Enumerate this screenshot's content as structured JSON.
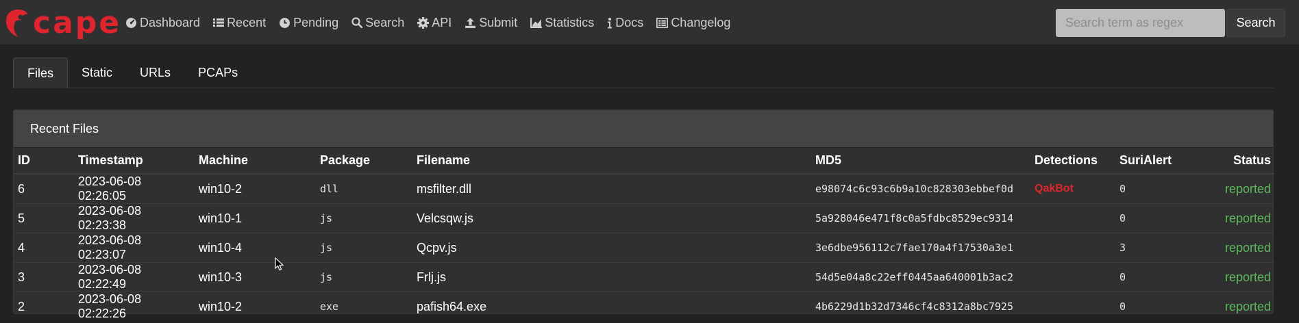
{
  "brand": {
    "name": "cape"
  },
  "nav": {
    "items": [
      {
        "label": "Dashboard",
        "icon": "dashboard-icon"
      },
      {
        "label": "Recent",
        "icon": "list-icon"
      },
      {
        "label": "Pending",
        "icon": "clock-icon"
      },
      {
        "label": "Search",
        "icon": "search-icon"
      },
      {
        "label": "API",
        "icon": "gear-icon"
      },
      {
        "label": "Submit",
        "icon": "upload-icon"
      },
      {
        "label": "Statistics",
        "icon": "chart-icon"
      },
      {
        "label": "Docs",
        "icon": "info-icon"
      },
      {
        "label": "Changelog",
        "icon": "changelog-icon"
      }
    ],
    "search_placeholder": "Search term as regex",
    "search_button": "Search"
  },
  "tabs": [
    "Files",
    "Static",
    "URLs",
    "PCAPs"
  ],
  "panel": {
    "title": "Recent Files",
    "columns": [
      "ID",
      "Timestamp",
      "Machine",
      "Package",
      "Filename",
      "MD5",
      "Detections",
      "SuriAlert",
      "Status"
    ],
    "rows": [
      {
        "id": "6",
        "timestamp": "2023-06-08 02:26:05",
        "machine": "win10-2",
        "package": "dll",
        "filename": "msfilter.dll",
        "md5": "e98074c6c93c6b9a10c828303ebbef0d",
        "detections": "QakBot",
        "surialert": "0",
        "status": "reported"
      },
      {
        "id": "5",
        "timestamp": "2023-06-08 02:23:38",
        "machine": "win10-1",
        "package": "js",
        "filename": "Velcsqw.js",
        "md5": "5a928046e471f8c0a5fdbc8529ec9314",
        "detections": "",
        "surialert": "0",
        "status": "reported"
      },
      {
        "id": "4",
        "timestamp": "2023-06-08 02:23:07",
        "machine": "win10-4",
        "package": "js",
        "filename": "Qcpv.js",
        "md5": "3e6dbe956112c7fae170a4f17530a3e1",
        "detections": "",
        "surialert": "3",
        "status": "reported"
      },
      {
        "id": "3",
        "timestamp": "2023-06-08 02:22:49",
        "machine": "win10-3",
        "package": "js",
        "filename": "Frlj.js",
        "md5": "54d5e04a8c22eff0445aa640001b3ac2",
        "detections": "",
        "surialert": "0",
        "status": "reported"
      },
      {
        "id": "2",
        "timestamp": "2023-06-08 02:22:26",
        "machine": "win10-2",
        "package": "exe",
        "filename": "pafish64.exe",
        "md5": "4b6229d1b32d7346cf4c8312a8bc7925",
        "detections": "",
        "surialert": "0",
        "status": "reported"
      }
    ]
  },
  "colors": {
    "brand": "#e0242e",
    "status_ok": "#5cb85c",
    "detection": "#e0242e"
  }
}
